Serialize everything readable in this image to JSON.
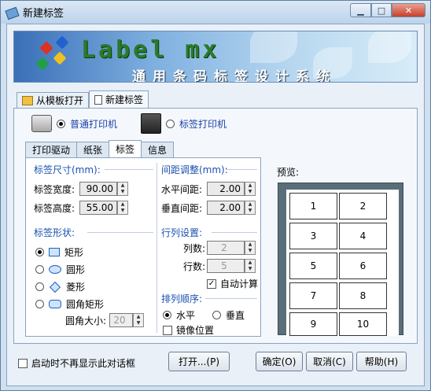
{
  "window": {
    "title": "新建标签"
  },
  "banner": {
    "logo": "Label mx",
    "subtitle": "通用条码标签设计系统"
  },
  "top_tabs": [
    {
      "label": "从模板打开"
    },
    {
      "label": "新建标签"
    }
  ],
  "printer": {
    "normal": "普通打印机",
    "label": "标签打印机"
  },
  "sub_tabs": [
    {
      "label": "打印驱动"
    },
    {
      "label": "纸张"
    },
    {
      "label": "标签"
    },
    {
      "label": "信息"
    }
  ],
  "label_size": {
    "title": "标签尺寸(mm):",
    "width_label": "标签宽度:",
    "width_value": "90.00",
    "height_label": "标签高度:",
    "height_value": "55.00"
  },
  "label_shape": {
    "title": "标签形状:",
    "options": [
      "矩形",
      "圆形",
      "菱形",
      "圆角矩形"
    ],
    "corner_label": "圆角大小:",
    "corner_value": "20"
  },
  "spacing": {
    "title": "间距调整(mm):",
    "h_label": "水平间距:",
    "h_value": "2.00",
    "v_label": "垂直间距:",
    "v_value": "2.00"
  },
  "grid": {
    "title": "行列设置:",
    "cols_label": "列数:",
    "cols_value": "2",
    "rows_label": "行数:",
    "rows_value": "5",
    "auto_calc": "自动计算"
  },
  "order": {
    "title": "排列顺序:",
    "horizontal": "水平",
    "vertical": "垂直",
    "mirror": "镜像位置"
  },
  "preview": {
    "title": "预览:",
    "cells": [
      "1",
      "2",
      "3",
      "4",
      "5",
      "6",
      "7",
      "8",
      "9",
      "10"
    ]
  },
  "footer": {
    "dont_show": "启动时不再显示此对话框",
    "open": "打开...(P)",
    "ok": "确定(O)",
    "cancel": "取消(C)",
    "help": "帮助(H)"
  }
}
